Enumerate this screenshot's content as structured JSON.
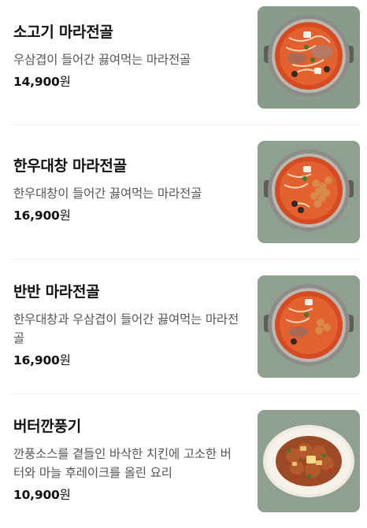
{
  "menu": {
    "items": [
      {
        "name": "소고기 마라전골",
        "description": "우삼겹이 들어간 끓여먹는 마라전골",
        "price": "14,900",
        "currency": "원",
        "image": "hotpot-beef-photo"
      },
      {
        "name": "한우대창 마라전골",
        "description": "한우대창이 들어간 끓여먹는 마라전골",
        "price": "16,900",
        "currency": "원",
        "image": "hotpot-tripe-photo"
      },
      {
        "name": "반반 마라전골",
        "description": "한우대창과 우삼겹이 들어간 끓여먹는 마라전골",
        "price": "16,900",
        "currency": "원",
        "image": "hotpot-half-photo"
      },
      {
        "name": "버터깐풍기",
        "description": "깐풍소스를 곁들인 바삭한 치킨에 고소한 버터와 마늘 후레이크를 올린 요리",
        "price": "10,900",
        "currency": "원",
        "image": "butter-chicken-photo"
      }
    ]
  }
}
